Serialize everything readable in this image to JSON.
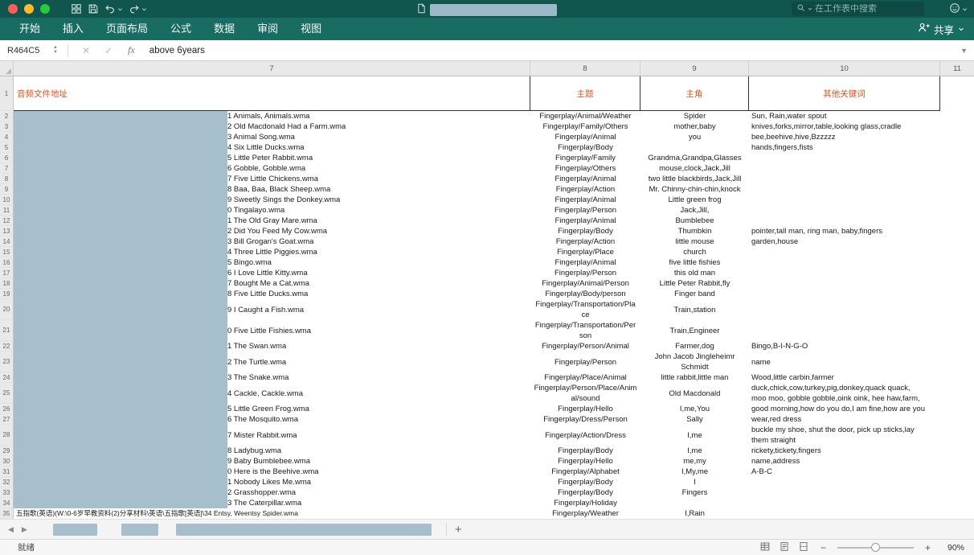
{
  "colors": {
    "titlebar_bg": "#11564e",
    "ribbon_bg": "#196c62",
    "redaction_blue": "#a7bfcd",
    "header_row_text": "#d85427",
    "traffic_lights": [
      "#ff5f57",
      "#febc2e",
      "#28c840"
    ]
  },
  "titlebar": {
    "icons": [
      "grid-view",
      "save",
      "undo",
      "redo"
    ],
    "search_placeholder": "在工作表中搜索"
  },
  "ribbon": {
    "tabs": [
      "开始",
      "插入",
      "页面布局",
      "公式",
      "数据",
      "审阅",
      "视图"
    ],
    "share_label": "共享"
  },
  "formula_bar": {
    "name_box": "R464C5",
    "fx_label": "fx",
    "value": "above 6years"
  },
  "grid": {
    "column_headers": [
      "7",
      "8",
      "9",
      "10",
      "11"
    ],
    "header_row": {
      "row_num": "1",
      "audio_path": "音频文件地址",
      "theme": "主题",
      "role": "主角",
      "keywords": "其他关键词"
    },
    "rows": [
      {
        "n": "2",
        "file": "1 Animals, Animals.wma",
        "theme": "Fingerplay/Animal/Weather",
        "role": "Spider",
        "kw": "Sun, Rain,water spout"
      },
      {
        "n": "3",
        "file": "2 Old Macdonald Had a Farm.wma",
        "theme": "Fingerplay/Family/Others",
        "role": "mother,baby",
        "kw": "knives,forks,mirror,table,looking glass,cradle"
      },
      {
        "n": "4",
        "file": "3 Animal Song.wma",
        "theme": "Fingerplay/Animal",
        "role": "you",
        "kw": "bee,beehive,hive,Bzzzzz"
      },
      {
        "n": "5",
        "file": "4 Six Little Ducks.wma",
        "theme": "Fingerplay/Body",
        "role": "",
        "kw": "hands,fingers,fists"
      },
      {
        "n": "6",
        "file": "5 Little Peter Rabbit.wma",
        "theme": "Fingerplay/Family",
        "role": "Grandma,Grandpa,Glasses",
        "kw": ""
      },
      {
        "n": "7",
        "file": "6 Gobble, Gobble.wma",
        "theme": "Fingerplay/Others",
        "role": "mouse,clock,Jack,Jill",
        "kw": ""
      },
      {
        "n": "8",
        "file": "7 Five Little Chickens.wma",
        "theme": "Fingerplay/Animal",
        "role": "two little blackbirds,Jack,Jill",
        "kw": ""
      },
      {
        "n": "9",
        "file": "8 Baa, Baa, Black Sheep.wma",
        "theme": "Fingerplay/Action",
        "role": "Mr. Chinny-chin-chin,knock",
        "kw": ""
      },
      {
        "n": "10",
        "file": "9 Sweetly Sings the Donkey.wma",
        "theme": "Fingerplay/Animal",
        "role": "Little green frog",
        "kw": ""
      },
      {
        "n": "11",
        "file": "0 Tingalayo.wma",
        "theme": "Fingerplay/Person",
        "role": "Jack,Jill,",
        "kw": ""
      },
      {
        "n": "12",
        "file": "1 The Old Gray Mare.wma",
        "theme": "Fingerplay/Animal",
        "role": "Bumblebee",
        "kw": ""
      },
      {
        "n": "13",
        "file": "2 Did You Feed My Cow.wma",
        "theme": "Fingerplay/Body",
        "role": "Thumbkin",
        "kw": "pointer,tall man, ring man, baby,fingers"
      },
      {
        "n": "14",
        "file": "3 Bill Grogan's Goat.wma",
        "theme": "Fingerplay/Action",
        "role": "little mouse",
        "kw": "garden,house"
      },
      {
        "n": "15",
        "file": "4 Three Little Piggies.wma",
        "theme": "Fingerplay/Place",
        "role": "church",
        "kw": ""
      },
      {
        "n": "16",
        "file": "5 Bingo.wma",
        "theme": "Fingerplay/Animal",
        "role": "five little fishies",
        "kw": ""
      },
      {
        "n": "17",
        "file": "6 I Love Little Kitty.wma",
        "theme": "Fingerplay/Person",
        "role": "this old man",
        "kw": ""
      },
      {
        "n": "18",
        "file": "7 Bought Me a Cat.wma",
        "theme": "Fingerplay/Animal/Person",
        "role": "Little Peter Rabbit,fly",
        "kw": ""
      },
      {
        "n": "19",
        "file": "8 Five Little Ducks.wma",
        "theme": "Fingerplay/Body/person",
        "role": "Finger band",
        "kw": ""
      },
      {
        "n": "20",
        "file": "9 I Caught a Fish.wma",
        "theme": "Fingerplay/Transportation/Pla\nce",
        "role": "Train,station",
        "kw": ""
      },
      {
        "n": "21",
        "file": "0 Five Little Fishies.wma",
        "theme": "Fingerplay/Transportation/Per\nson",
        "role": "Train,Engineer",
        "kw": ""
      },
      {
        "n": "22",
        "file": "1 The Swan.wma",
        "theme": "Fingerplay/Person/Animal",
        "role": "Farmer,dog",
        "kw": "Bingo,B-I-N-G-O"
      },
      {
        "n": "23",
        "file": "2 The Turtle.wma",
        "theme": "Fingerplay/Person",
        "role": "John Jacob Jingleheimr\nSchmidt",
        "kw": "name"
      },
      {
        "n": "24",
        "file": "3 The Snake.wma",
        "theme": "Fingerplay/Place/Animal",
        "role": "little rabbit,little man",
        "kw": "Wood,little carbin,farmer"
      },
      {
        "n": "25",
        "file": "4 Cackle, Cackle.wma",
        "theme": "Fingerplay/Person/Place/Anim\nal/sound",
        "role": "Old Macdonald",
        "kw": "duck,chick,cow,turkey,pig,donkey,quack quack,\nmoo moo, gobble gobble,oink oink, hee haw,farm,"
      },
      {
        "n": "26",
        "file": "5 Little Green Frog.wma",
        "theme": "Fingerplay/Hello",
        "role": "I,me,You",
        "kw": "good morning,how do you do,I am fine,how are you"
      },
      {
        "n": "27",
        "file": "6 The Mosquito.wma",
        "theme": "Fingerplay/Dress/Person",
        "role": "Sally",
        "kw": "wear,red dress"
      },
      {
        "n": "28",
        "file": "7 Mister Rabbit.wma",
        "theme": "Fingerplay/Action/Dress",
        "role": "I,me",
        "kw": "buckle my shoe, shut the door, pick up sticks,lay\nthem straight"
      },
      {
        "n": "29",
        "file": "8 Ladybug.wma",
        "theme": "Fingerplay/Body",
        "role": "I,me",
        "kw": "rickety,tickety,fingers"
      },
      {
        "n": "30",
        "file": "9 Baby Bumblebee.wma",
        "theme": "Fingerplay/Hello",
        "role": "me,my",
        "kw": "name,address"
      },
      {
        "n": "31",
        "file": "0 Here is the Beehive.wma",
        "theme": "Fingerplay/Alphabet",
        "role": "I,My,me",
        "kw": "A-B-C"
      },
      {
        "n": "32",
        "file": "1 Nobody Likes Me.wma",
        "theme": "Fingerplay/Body",
        "role": "I",
        "kw": ""
      },
      {
        "n": "33",
        "file": "2 Grasshopper.wma",
        "theme": "Fingerplay/Body",
        "role": "Fingers",
        "kw": ""
      },
      {
        "n": "34",
        "file": "3 The Caterpillar.wma",
        "theme": "Fingerplay/Holiday",
        "role": "",
        "kw": ""
      },
      {
        "n": "35",
        "file": "五指歌(英语)(W:\\0-6岁早教资料(2)分享材料\\英语\\五指歌[英语]\\34 Entsy, Weentsy Spider.wma",
        "theme": "Fingerplay/Weather",
        "role": "I,Rain",
        "kw": "",
        "full": true
      }
    ]
  },
  "sheetbar": {
    "add_label": "+"
  },
  "statusbar": {
    "ready": "就绪",
    "zoom_value": "90%"
  }
}
